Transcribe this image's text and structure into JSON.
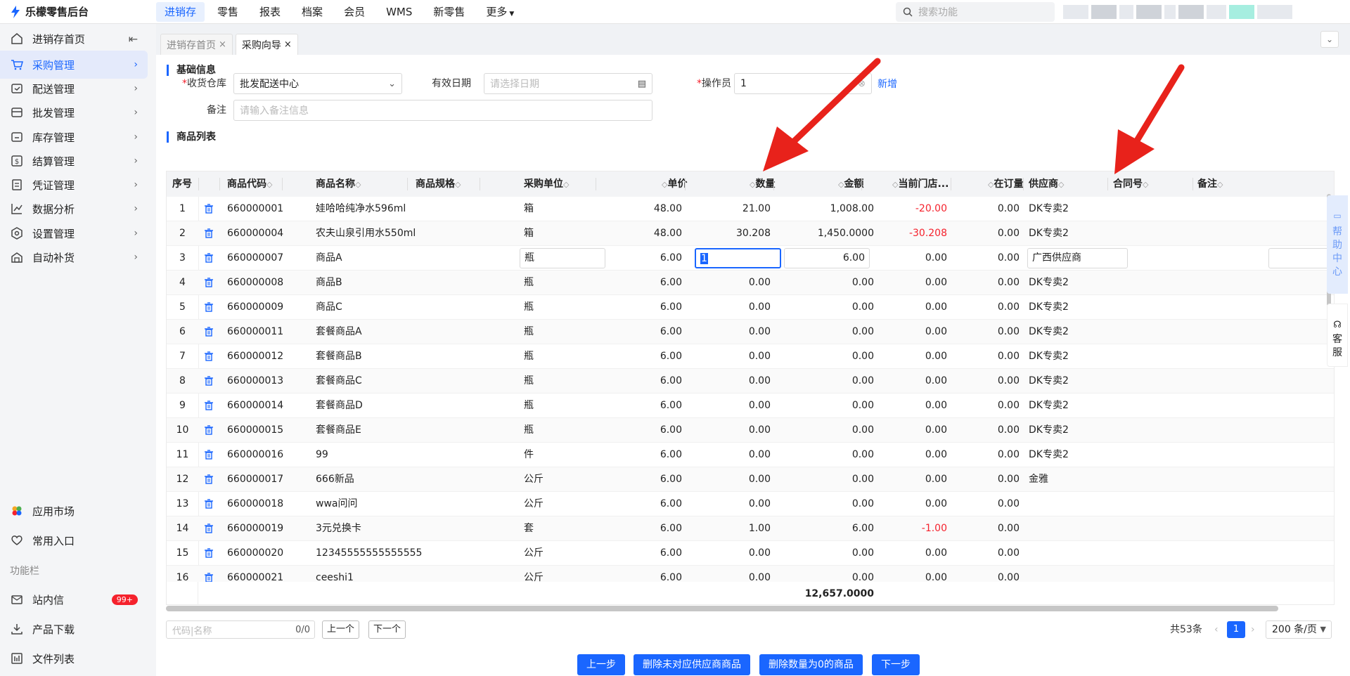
{
  "app": {
    "title": "乐檬零售后台"
  },
  "topnav": [
    "进销存",
    "零售",
    "报表",
    "档案",
    "会员",
    "WMS",
    "新零售",
    "更多"
  ],
  "search": {
    "placeholder": "搜索功能"
  },
  "sidebar": {
    "items": [
      {
        "label": "进销存首页",
        "icon": "home-icon"
      },
      {
        "label": "采购管理",
        "icon": "cart-icon"
      },
      {
        "label": "配送管理",
        "icon": "delivery-icon"
      },
      {
        "label": "批发管理",
        "icon": "wholesale-icon"
      },
      {
        "label": "库存管理",
        "icon": "inventory-icon"
      },
      {
        "label": "结算管理",
        "icon": "settlement-icon"
      },
      {
        "label": "凭证管理",
        "icon": "voucher-icon"
      },
      {
        "label": "数据分析",
        "icon": "chart-icon"
      },
      {
        "label": "设置管理",
        "icon": "settings-icon"
      },
      {
        "label": "自动补货",
        "icon": "replenish-icon"
      }
    ],
    "bottom": [
      {
        "label": "应用市场",
        "icon": "apps-icon"
      },
      {
        "label": "常用入口",
        "icon": "heart-icon"
      }
    ],
    "section_label": "功能栏",
    "utility": [
      {
        "label": "站内信",
        "icon": "mail-icon",
        "badge": "99+"
      },
      {
        "label": "产品下载",
        "icon": "download-icon"
      },
      {
        "label": "文件列表",
        "icon": "file-list-icon"
      }
    ]
  },
  "tabs": [
    {
      "label": "进销存首页"
    },
    {
      "label": "采购向导"
    }
  ],
  "form": {
    "section_basic": "基础信息",
    "warehouse": {
      "label": "收货仓库",
      "value": "批发配送中心"
    },
    "valid_date": {
      "label": "有效日期",
      "placeholder": "请选择日期"
    },
    "operator": {
      "label": "操作员",
      "value": "1",
      "add": "新增"
    },
    "remark": {
      "label": "备注",
      "placeholder": "请输入备注信息"
    },
    "section_goods": "商品列表"
  },
  "table": {
    "headers": [
      "序号",
      "商品代码",
      "商品名称",
      "商品规格",
      "采购单位",
      "单价",
      "数量",
      "金额",
      "当前门店...",
      "在订量",
      "供应商",
      "合同号",
      "备注"
    ],
    "rows": [
      {
        "no": "1",
        "code": "660000001",
        "name": "娃哈哈纯净水596ml",
        "unit": "箱",
        "price": "48.00",
        "qty": "21.00",
        "amount": "1,008.00",
        "stock": "-20.00",
        "onorder": "0.00",
        "supplier": "DK专卖2"
      },
      {
        "no": "2",
        "code": "660000004",
        "name": "农夫山泉引用水550ml",
        "unit": "箱",
        "price": "48.00",
        "qty": "30.208",
        "amount": "1,450.0000",
        "stock": "-30.208",
        "onorder": "0.00",
        "supplier": "DK专卖2"
      },
      {
        "no": "3",
        "code": "660000007",
        "name": "商品A",
        "unit": "瓶",
        "price": "6.00",
        "qty": "1",
        "amount": "6.00",
        "stock": "0.00",
        "onorder": "0.00",
        "supplier": "广西供应商"
      },
      {
        "no": "4",
        "code": "660000008",
        "name": "商品B",
        "unit": "瓶",
        "price": "6.00",
        "qty": "0.00",
        "amount": "0.00",
        "stock": "0.00",
        "onorder": "0.00",
        "supplier": "DK专卖2"
      },
      {
        "no": "5",
        "code": "660000009",
        "name": "商品C",
        "unit": "瓶",
        "price": "6.00",
        "qty": "0.00",
        "amount": "0.00",
        "stock": "0.00",
        "onorder": "0.00",
        "supplier": "DK专卖2"
      },
      {
        "no": "6",
        "code": "660000011",
        "name": "套餐商品A",
        "unit": "瓶",
        "price": "6.00",
        "qty": "0.00",
        "amount": "0.00",
        "stock": "0.00",
        "onorder": "0.00",
        "supplier": "DK专卖2"
      },
      {
        "no": "7",
        "code": "660000012",
        "name": "套餐商品B",
        "unit": "瓶",
        "price": "6.00",
        "qty": "0.00",
        "amount": "0.00",
        "stock": "0.00",
        "onorder": "0.00",
        "supplier": "DK专卖2"
      },
      {
        "no": "8",
        "code": "660000013",
        "name": "套餐商品C",
        "unit": "瓶",
        "price": "6.00",
        "qty": "0.00",
        "amount": "0.00",
        "stock": "0.00",
        "onorder": "0.00",
        "supplier": "DK专卖2"
      },
      {
        "no": "9",
        "code": "660000014",
        "name": "套餐商品D",
        "unit": "瓶",
        "price": "6.00",
        "qty": "0.00",
        "amount": "0.00",
        "stock": "0.00",
        "onorder": "0.00",
        "supplier": "DK专卖2"
      },
      {
        "no": "10",
        "code": "660000015",
        "name": "套餐商品E",
        "unit": "瓶",
        "price": "6.00",
        "qty": "0.00",
        "amount": "0.00",
        "stock": "0.00",
        "onorder": "0.00",
        "supplier": "DK专卖2"
      },
      {
        "no": "11",
        "code": "660000016",
        "name": "99",
        "unit": "件",
        "price": "6.00",
        "qty": "0.00",
        "amount": "0.00",
        "stock": "0.00",
        "onorder": "0.00",
        "supplier": "DK专卖2"
      },
      {
        "no": "12",
        "code": "660000017",
        "name": "666新品",
        "unit": "公斤",
        "price": "6.00",
        "qty": "0.00",
        "amount": "0.00",
        "stock": "0.00",
        "onorder": "0.00",
        "supplier": "金雅"
      },
      {
        "no": "13",
        "code": "660000018",
        "name": "wwa问问",
        "unit": "公斤",
        "price": "6.00",
        "qty": "0.00",
        "amount": "0.00",
        "stock": "0.00",
        "onorder": "0.00",
        "supplier": ""
      },
      {
        "no": "14",
        "code": "660000019",
        "name": "3元兑换卡",
        "unit": "套",
        "price": "6.00",
        "qty": "1.00",
        "amount": "6.00",
        "stock": "-1.00",
        "onorder": "0.00",
        "supplier": ""
      },
      {
        "no": "15",
        "code": "660000020",
        "name": "12345555555555555",
        "unit": "公斤",
        "price": "6.00",
        "qty": "0.00",
        "amount": "0.00",
        "stock": "0.00",
        "onorder": "0.00",
        "supplier": ""
      },
      {
        "no": "16",
        "code": "660000021",
        "name": "ceeshi1",
        "unit": "公斤",
        "price": "6.00",
        "qty": "0.00",
        "amount": "0.00",
        "stock": "0.00",
        "onorder": "0.00",
        "supplier": ""
      }
    ],
    "total_amount": "12,657.0000"
  },
  "finder": {
    "placeholder": "代码|名称",
    "count": "0/0",
    "prev": "上一个",
    "next": "下一个"
  },
  "pager": {
    "total": "共53条",
    "current": "1",
    "size": "200 条/页"
  },
  "actions": [
    "上一步",
    "删除未对应供应商商品",
    "删除数量为0的商品",
    "下一步"
  ],
  "float": {
    "help": [
      "帮",
      "助",
      "中",
      "心"
    ],
    "service": [
      "客",
      "服"
    ]
  },
  "colors": {
    "accent": "#1a66ff",
    "negative": "#f5222d",
    "annotation_arrow": "#e8221b"
  }
}
